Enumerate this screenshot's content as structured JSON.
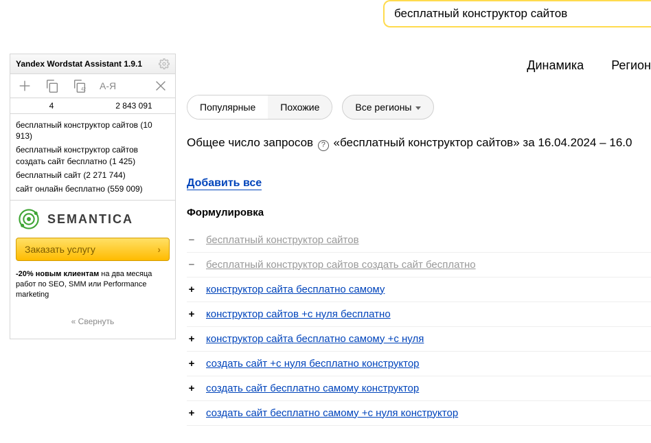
{
  "search": {
    "query": "бесплатный конструктор сайтов"
  },
  "topnav": {
    "item1": "Динамика",
    "item2": "Регион"
  },
  "sidebar": {
    "title": "Yandex Wordstat Assistant 1.9.1",
    "sort_label": "А-Я",
    "count_left": "4",
    "count_right": "2 843 091",
    "items": [
      "бесплатный конструктор сайтов (10 913)",
      "бесплатный конструктор сайтов создать сайт бесплатно (1 425)",
      "бесплатный сайт (2 271 744)",
      "сайт онлайн бесплатно (559 009)"
    ],
    "logo_text": "SEMANTICA",
    "cta": "Заказать услугу",
    "promo_bold": "-20% новым клиентам",
    "promo_tail": " на два месяца работ по SEO, SMM или Performance marketing",
    "collapse": "« Свернуть"
  },
  "pills": {
    "popular": "Популярные",
    "similar": "Похожие",
    "regions": "Все регионы"
  },
  "summary": {
    "prefix": "Общее число запросов ",
    "query": "«бесплатный конструктор сайтов»",
    "mid": " за ",
    "dates": "16.04.2024 – 16.0"
  },
  "addall": "Добавить все",
  "table_header": "Формулировка",
  "rows": [
    {
      "sign": "−",
      "text": "бесплатный конструктор сайтов",
      "type": "disabled"
    },
    {
      "sign": "−",
      "text": "бесплатный конструктор сайтов создать сайт бесплатно",
      "type": "disabled"
    },
    {
      "sign": "+",
      "text": "конструктор сайта бесплатно самому",
      "type": "link"
    },
    {
      "sign": "+",
      "text": "конструктор сайтов +с нуля бесплатно",
      "type": "link"
    },
    {
      "sign": "+",
      "text": "конструктор сайта бесплатно самому +с нуля",
      "type": "link"
    },
    {
      "sign": "+",
      "text": "создать сайт +с нуля бесплатно конструктор",
      "type": "link"
    },
    {
      "sign": "+",
      "text": "создать сайт бесплатно самому конструктор",
      "type": "link"
    },
    {
      "sign": "+",
      "text": "создать сайт бесплатно самому +с нуля конструктор",
      "type": "link"
    }
  ]
}
